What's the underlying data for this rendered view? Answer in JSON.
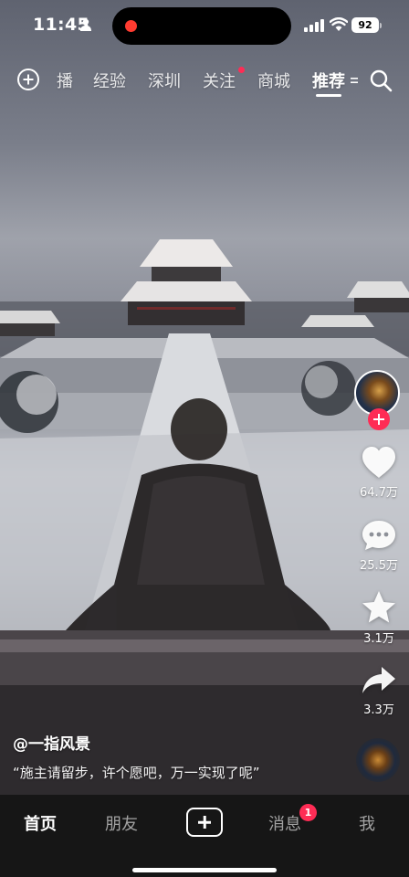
{
  "status_bar": {
    "time": "11:45",
    "battery": "92"
  },
  "top_nav": {
    "tabs": [
      {
        "label": "播"
      },
      {
        "label": "经验"
      },
      {
        "label": "深圳"
      },
      {
        "label": "关注"
      },
      {
        "label": "商城"
      },
      {
        "label": "推荐"
      }
    ],
    "active_tab": "推荐"
  },
  "side_actions": {
    "likes": "64.7万",
    "comments": "25.5万",
    "favorites": "3.1万",
    "shares": "3.3万"
  },
  "post": {
    "author": "@一指风景",
    "caption": "“施主请留步，许个愿吧，万一实现了呢”"
  },
  "bottom_nav": {
    "items": [
      {
        "label": "首页"
      },
      {
        "label": "朋友"
      },
      {
        "label": "消息"
      },
      {
        "label": "我"
      }
    ],
    "messages_badge": "1"
  },
  "colors": {
    "accent": "#fe2c55",
    "nav_bg": "#161616"
  }
}
